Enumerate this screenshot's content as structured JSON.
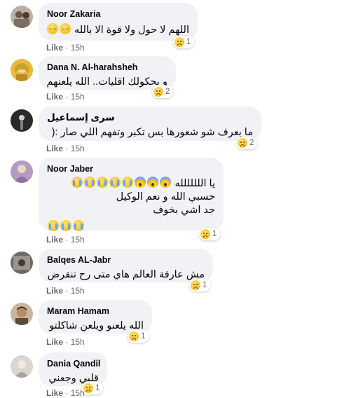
{
  "comments": [
    {
      "name": "Noor Zakaria",
      "text": "اللهم لا حول ولا قوة الا بالله",
      "like": "Like",
      "time": "15h",
      "reactions": "1"
    },
    {
      "name": "Dana N. Al-harahsheh",
      "text": "و بحكولك اقليات.. الله يلعنهم",
      "like": "Like",
      "time": "15h",
      "reactions": "2"
    },
    {
      "name": "سرى إسماعيل",
      "text": "ما بعرف شو شعورها بس تكبر وتفهم اللي صار :(",
      "like": "Like",
      "time": "15h",
      "reactions": "2"
    },
    {
      "name": "Noor Jaber",
      "text_line1": "يا اللللللله",
      "text_line2": "حسبي الله و نعم الوكيل",
      "text_line3": "جد اشي بخوف",
      "like": "Like",
      "time": "15h",
      "reactions": "1"
    },
    {
      "name": "Balqes AL-Jabr",
      "text": "مش عارفة العالم هاي متى رح تنقرض",
      "like": "Like",
      "time": "15h",
      "reactions": "1"
    },
    {
      "name": "Maram Hamam",
      "text": "الله يلعنو ويلعن شاكلتو",
      "like": "Like",
      "time": "15h",
      "reactions": "1"
    },
    {
      "name": "Dania Qandil",
      "text": "قلبي وجعني",
      "like": "Like",
      "time": "15h",
      "reactions": "1"
    }
  ],
  "icons": {
    "reaction": "sad-reaction-icon",
    "emoji_relieved": "relieved-face-icon",
    "emoji_scream": "screaming-face-icon",
    "emoji_sob": "crying-face-icon"
  }
}
